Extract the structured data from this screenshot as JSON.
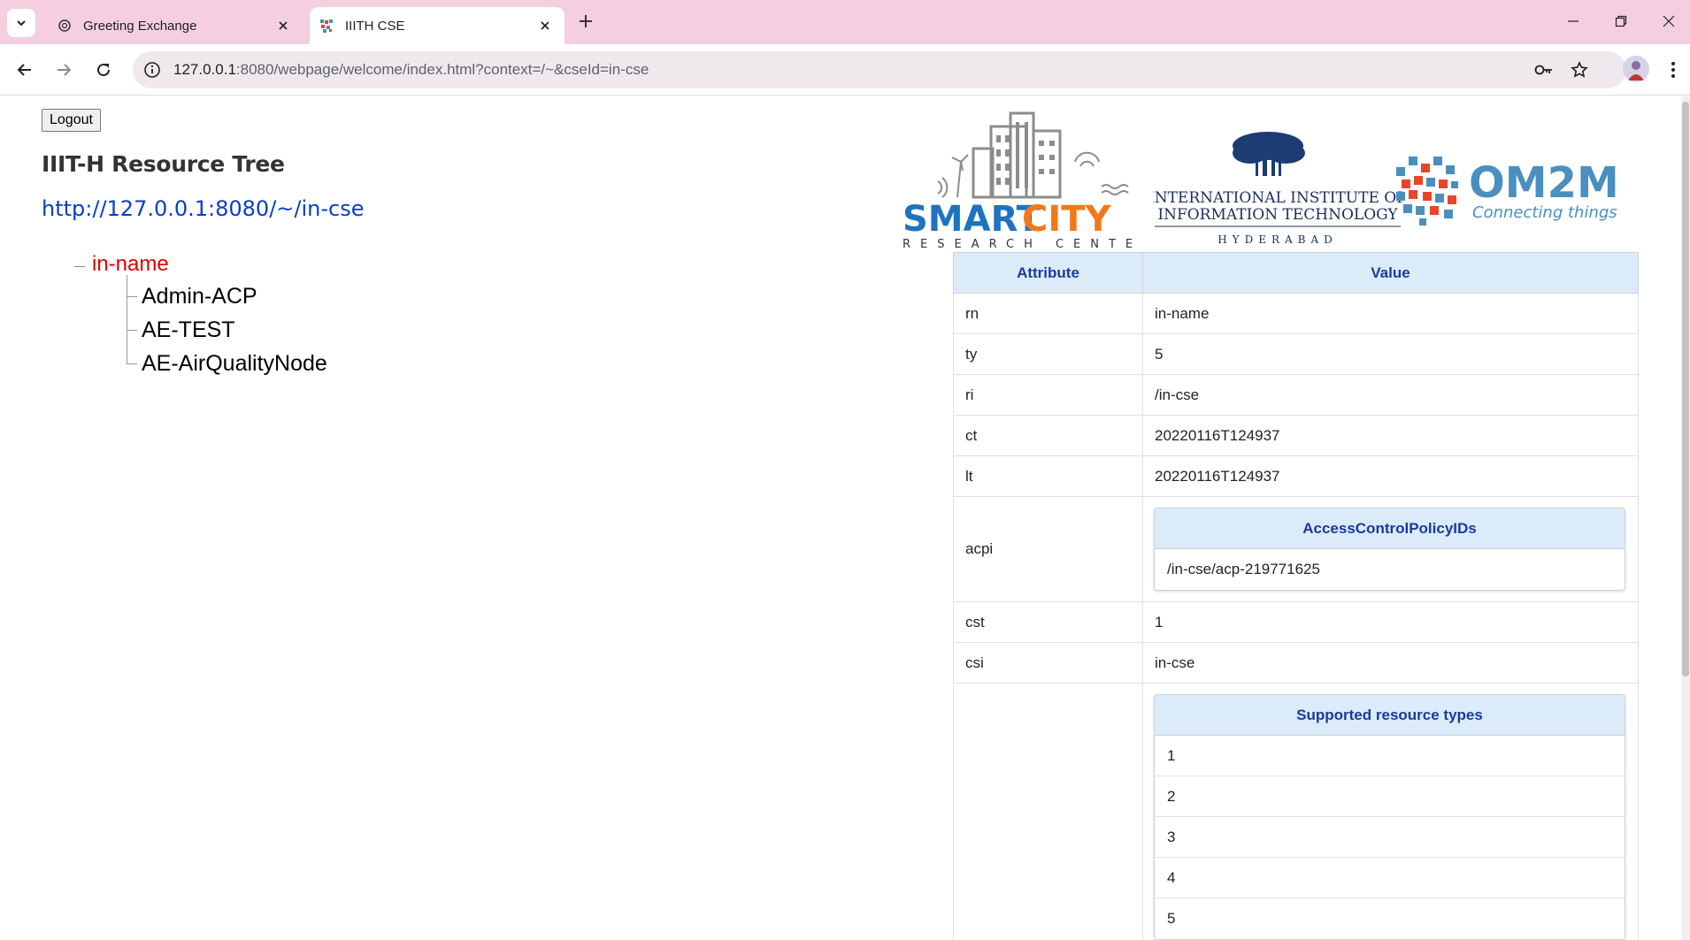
{
  "browser": {
    "tabs": [
      {
        "title": "Greeting Exchange",
        "active": false
      },
      {
        "title": "IIITH CSE",
        "active": true
      }
    ],
    "url_host": "127.0.0.1",
    "url_rest": ":8080/webpage/welcome/index.html?context=/~&cseId=in-cse"
  },
  "page": {
    "logout_label": "Logout",
    "tree_title": "IIIT-H Resource Tree",
    "cse_url": "http://127.0.0.1:8080/~/in-cse",
    "tree": {
      "root": "in-name",
      "children": [
        "Admin-ACP",
        "AE-TEST",
        "AE-AirQualityNode"
      ]
    },
    "logos": {
      "smartcity_a": "SMART",
      "smartcity_b": "CITY",
      "smartcity_sub": "RESEARCH CENTER",
      "iiit_line1": "INTERNATIONAL INSTITUTE OF",
      "iiit_line2": "INFORMATION TECHNOLOGY",
      "iiit_line3": "HYDERABAD",
      "om2m_name": "OM2M",
      "om2m_tag": "Connecting things"
    },
    "table": {
      "head_attr": "Attribute",
      "head_value": "Value",
      "rows": [
        {
          "k": "rn",
          "v": "in-name"
        },
        {
          "k": "ty",
          "v": "5"
        },
        {
          "k": "ri",
          "v": "/in-cse"
        },
        {
          "k": "ct",
          "v": "20220116T124937"
        },
        {
          "k": "lt",
          "v": "20220116T124937"
        },
        {
          "k": "acpi"
        },
        {
          "k": "cst",
          "v": "1"
        },
        {
          "k": "csi",
          "v": "in-cse"
        }
      ],
      "acpi": {
        "title": "AccessControlPolicyIDs",
        "items": [
          "/in-cse/acp-219771625"
        ]
      },
      "srt": {
        "title": "Supported resource types",
        "items": [
          "1",
          "2",
          "3",
          "4",
          "5"
        ]
      }
    }
  },
  "colors": {
    "tabstrip": "#f5cfe0",
    "link": "#0b3ec6",
    "tree_root": "#e00000",
    "table_header_bg": "#dcebfa",
    "table_header_text": "#1a3aa0",
    "smart_blue": "#1e73be",
    "city_orange": "#f07a1a",
    "om2m_blue": "#4a8fbf",
    "om2m_orange": "#e8462a"
  }
}
